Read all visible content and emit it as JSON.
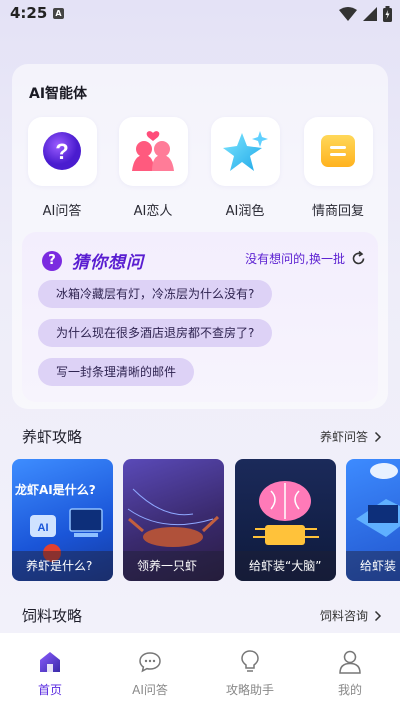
{
  "status_bar": {
    "time": "4:25",
    "notification_letter": "A"
  },
  "agent_section": {
    "title": "AI智能体",
    "items": [
      {
        "label": "AI问答",
        "icon": "question-bubble-icon"
      },
      {
        "label": "AI恋人",
        "icon": "couple-icon"
      },
      {
        "label": "AI润色",
        "icon": "sparkle-star-icon"
      },
      {
        "label": "情商回复",
        "icon": "message-note-icon"
      }
    ]
  },
  "ask_section": {
    "title": "猜你想问",
    "refresh_label": "没有想问的,换一批",
    "questions": [
      "冰箱冷藏层有灯，冷冻层为什么没有?",
      "为什么现在很多酒店退房都不查房了?",
      "写一封条理清晰的邮件"
    ]
  },
  "shrimp_guide": {
    "title": "养虾攻略",
    "link_label": "养虾问答",
    "cards": [
      {
        "caption": "养虾是什么?",
        "overlay_text": "龙虾AI是什么?"
      },
      {
        "caption": "领养一只虾"
      },
      {
        "caption": "给虾装“大脑”"
      },
      {
        "caption": "给虾装"
      }
    ]
  },
  "feed_guide": {
    "title": "饲料攻略",
    "link_label": "饲料咨询"
  },
  "bottom_nav": [
    {
      "label": "首页",
      "icon": "home-icon",
      "active": true
    },
    {
      "label": "AI问答",
      "icon": "chat-bubble-icon",
      "active": false
    },
    {
      "label": "攻略助手",
      "icon": "lightbulb-icon",
      "active": false
    },
    {
      "label": "我的",
      "icon": "profile-icon",
      "active": false
    }
  ],
  "colors": {
    "accent": "#5a1ed1",
    "chip_bg": "#ddd2f6",
    "nav_active": "#5a2be0"
  }
}
